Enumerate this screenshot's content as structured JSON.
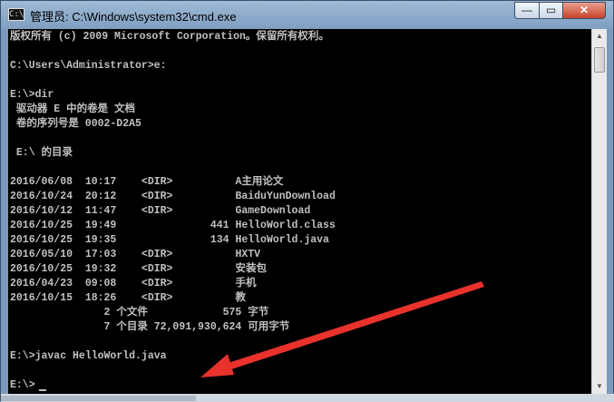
{
  "window": {
    "title": "管理员: C:\\Windows\\system32\\cmd.exe",
    "icon_text": "C:\\",
    "buttons": {
      "minimize": "—",
      "maximize": "▭",
      "close": "✕"
    }
  },
  "console": {
    "lines": [
      "版权所有 (c) 2009 Microsoft Corporation。保留所有权利。",
      "",
      "C:\\Users\\Administrator>e:",
      "",
      "E:\\>dir",
      " 驱动器 E 中的卷是 文档",
      " 卷的序列号是 0002-D2A5",
      "",
      " E:\\ 的目录",
      "",
      "2016/06/08  10:17    <DIR>          A主用论文",
      "2016/10/24  20:12    <DIR>          BaiduYunDownload",
      "2016/10/12  11:47    <DIR>          GameDownload",
      "2016/10/25  19:49               441 HelloWorld.class",
      "2016/10/25  19:35               134 HelloWorld.java",
      "2016/05/10  17:03    <DIR>          HXTV",
      "2016/10/25  19:32    <DIR>          安装包",
      "2016/04/23  09:08    <DIR>          手机",
      "2016/10/15  18:26    <DIR>          教",
      "               2 个文件            575 字节",
      "               7 个目录 72,091,930,624 可用字节",
      "",
      "E:\\>javac HelloWorld.java",
      "",
      "E:\\>"
    ]
  },
  "colors": {
    "console_bg": "#000000",
    "console_text": "#c0c0c0",
    "titlebar": "#8eaccc",
    "close_button": "#c7422b",
    "annotation_arrow": "#e8322b"
  }
}
